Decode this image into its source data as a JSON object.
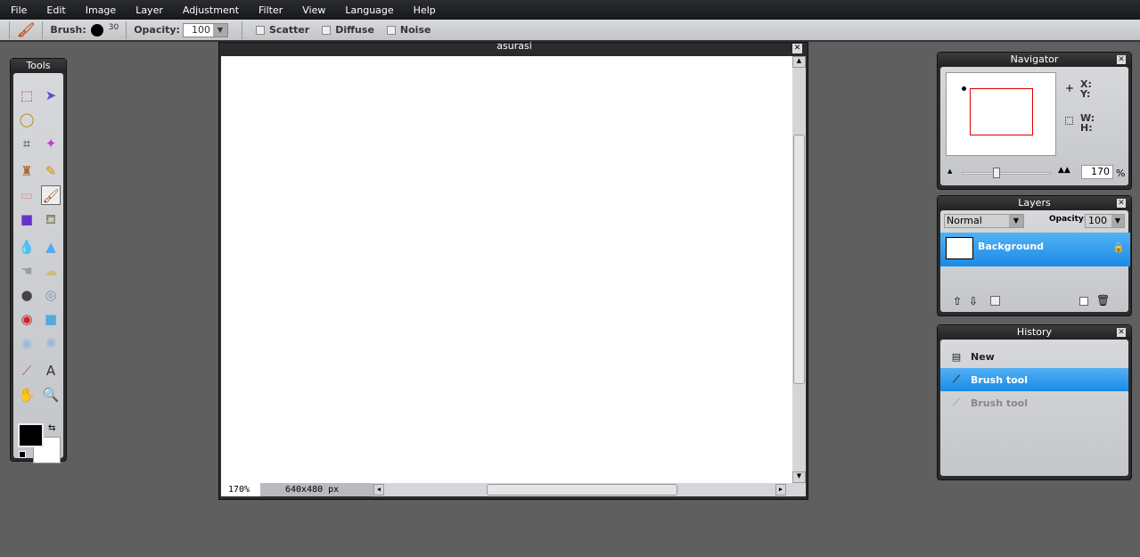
{
  "menu": [
    "File",
    "Edit",
    "Image",
    "Layer",
    "Adjustment",
    "Filter",
    "View",
    "Language",
    "Help"
  ],
  "toolbar": {
    "brush_label": "Brush:",
    "brush_size": "30",
    "opacity_label": "Opacity:",
    "opacity_value": "100",
    "scatter": "Scatter",
    "diffuse": "Diffuse",
    "noise": "Noise"
  },
  "tools": {
    "title": "Tools",
    "items": [
      "marquee",
      "move",
      "lasso",
      "",
      "crop",
      "magic-wand",
      "clone-stamp",
      "pencil",
      "eraser",
      "brush",
      "gradient",
      "paint-bucket",
      "blur",
      "sharpen",
      "smudge",
      "sponge",
      "burn",
      "dodge",
      "red-eye",
      "spot-heal",
      "bloat",
      "pinch",
      "color-picker",
      "text",
      "hand",
      "zoom"
    ],
    "primary_color": "#000000",
    "secondary_color": "#ffffff"
  },
  "document": {
    "title": "asurasi",
    "zoom": "170%",
    "size": "640x480 px"
  },
  "navigator": {
    "title": "Navigator",
    "x_label": "X:",
    "y_label": "Y:",
    "w_label": "W:",
    "h_label": "H:",
    "zoom_value": "170",
    "zoom_unit": "%",
    "zoom_fraction": 0.37
  },
  "layers": {
    "title": "Layers",
    "blend_mode": "Normal",
    "opacity_label": "Opacity:",
    "opacity_value": "100",
    "items": [
      {
        "name": "Background",
        "selected": true,
        "locked": true
      }
    ]
  },
  "history": {
    "title": "History",
    "items": [
      {
        "label": "New",
        "state": "normal"
      },
      {
        "label": "Brush tool",
        "state": "selected"
      },
      {
        "label": "Brush tool",
        "state": "undone"
      }
    ]
  },
  "colors": {
    "selection": "#3fa3ee",
    "accent_red": "#e00000"
  }
}
